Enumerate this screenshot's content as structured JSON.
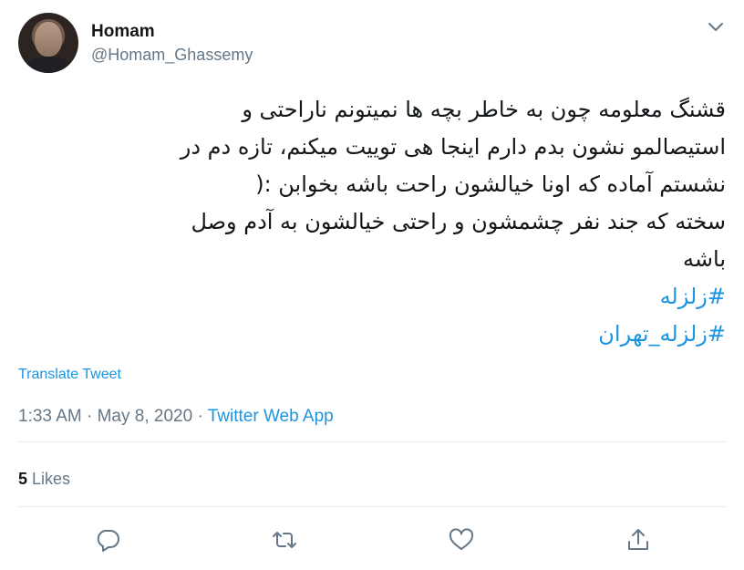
{
  "user": {
    "display_name": "Homam",
    "handle": "@Homam_Ghassemy"
  },
  "tweet": {
    "lines": [
      "قشنگ معلومه چون به خاطر بچه ها نمیتونم ناراحتی و",
      "استیصالمو نشون بدم دارم اینجا هی توییت میکنم،  تازه دم در",
      "نشستم آماده که اونا خیالشون راحت باشه بخوابن :(",
      "سخته که جند نفر چشمشون و راحتی خیالشون به آدم وصل",
      "باشه"
    ],
    "hashtags": [
      "#زلزله",
      "#زلزله_تهران"
    ]
  },
  "translate_label": "Translate Tweet",
  "meta": {
    "time": "1:33 AM",
    "separator": "·",
    "date": "May 8, 2020",
    "source": "Twitter Web App"
  },
  "engagement": {
    "likes_count": "5",
    "likes_label": "Likes"
  },
  "actions": {
    "reply_icon": "reply-icon",
    "retweet_icon": "retweet-icon",
    "like_icon": "heart-icon",
    "share_icon": "share-icon"
  },
  "colors": {
    "link": "#1b95e0",
    "secondary_text": "#657786",
    "primary_text": "#14171a",
    "divider": "#e6ecf0"
  }
}
